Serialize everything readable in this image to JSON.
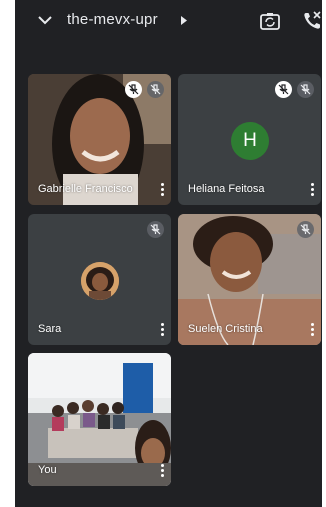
{
  "header": {
    "meeting_code": "the-mevx-upr",
    "icons": [
      "chevron-down-icon",
      "caret-right-icon",
      "switch-camera-icon",
      "phone-hangup-icon"
    ]
  },
  "participants": [
    {
      "name": "Gabrielle Francisco",
      "muted": true,
      "extra_icon": "presenter-muted-icon"
    },
    {
      "name": "Heliana Feitosa",
      "avatar_letter": "H",
      "avatar_color": "#2e7d32",
      "muted": true
    },
    {
      "name": "Sara",
      "muted": true
    },
    {
      "name": "Suelen Cristina",
      "muted": true
    },
    {
      "name": "You"
    }
  ],
  "colors": {
    "background": "#202124",
    "tile": "#3c4043",
    "text": "#ffffff"
  }
}
